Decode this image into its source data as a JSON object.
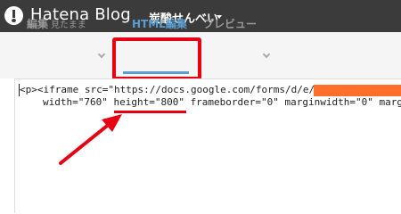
{
  "header": {
    "brand": "Hatena Blog",
    "blog_name": "炭酸せんべい"
  },
  "tabs": [
    {
      "label": "編集",
      "sublabel": "見たまま",
      "active": false
    },
    {
      "label": "HTML編集",
      "active": true
    },
    {
      "label": "プレビュー",
      "active": false
    }
  ],
  "editor": {
    "line1": "<p><iframe src=\"https://docs.google.com/forms/d/e/",
    "line2": "width=\"760\" height=\"800\" frameborder=\"0\" marginwidth=\"0\" marg"
  },
  "colors": {
    "header_bg": "#3b3b3b",
    "active_tab": "#5a9fd4",
    "highlight": "#e60012",
    "redaction": "#ff6f2c"
  },
  "icons": [
    "hatena-logo-icon",
    "caret-down-icon",
    "chevron-down-icon",
    "red-arrow-icon"
  ]
}
